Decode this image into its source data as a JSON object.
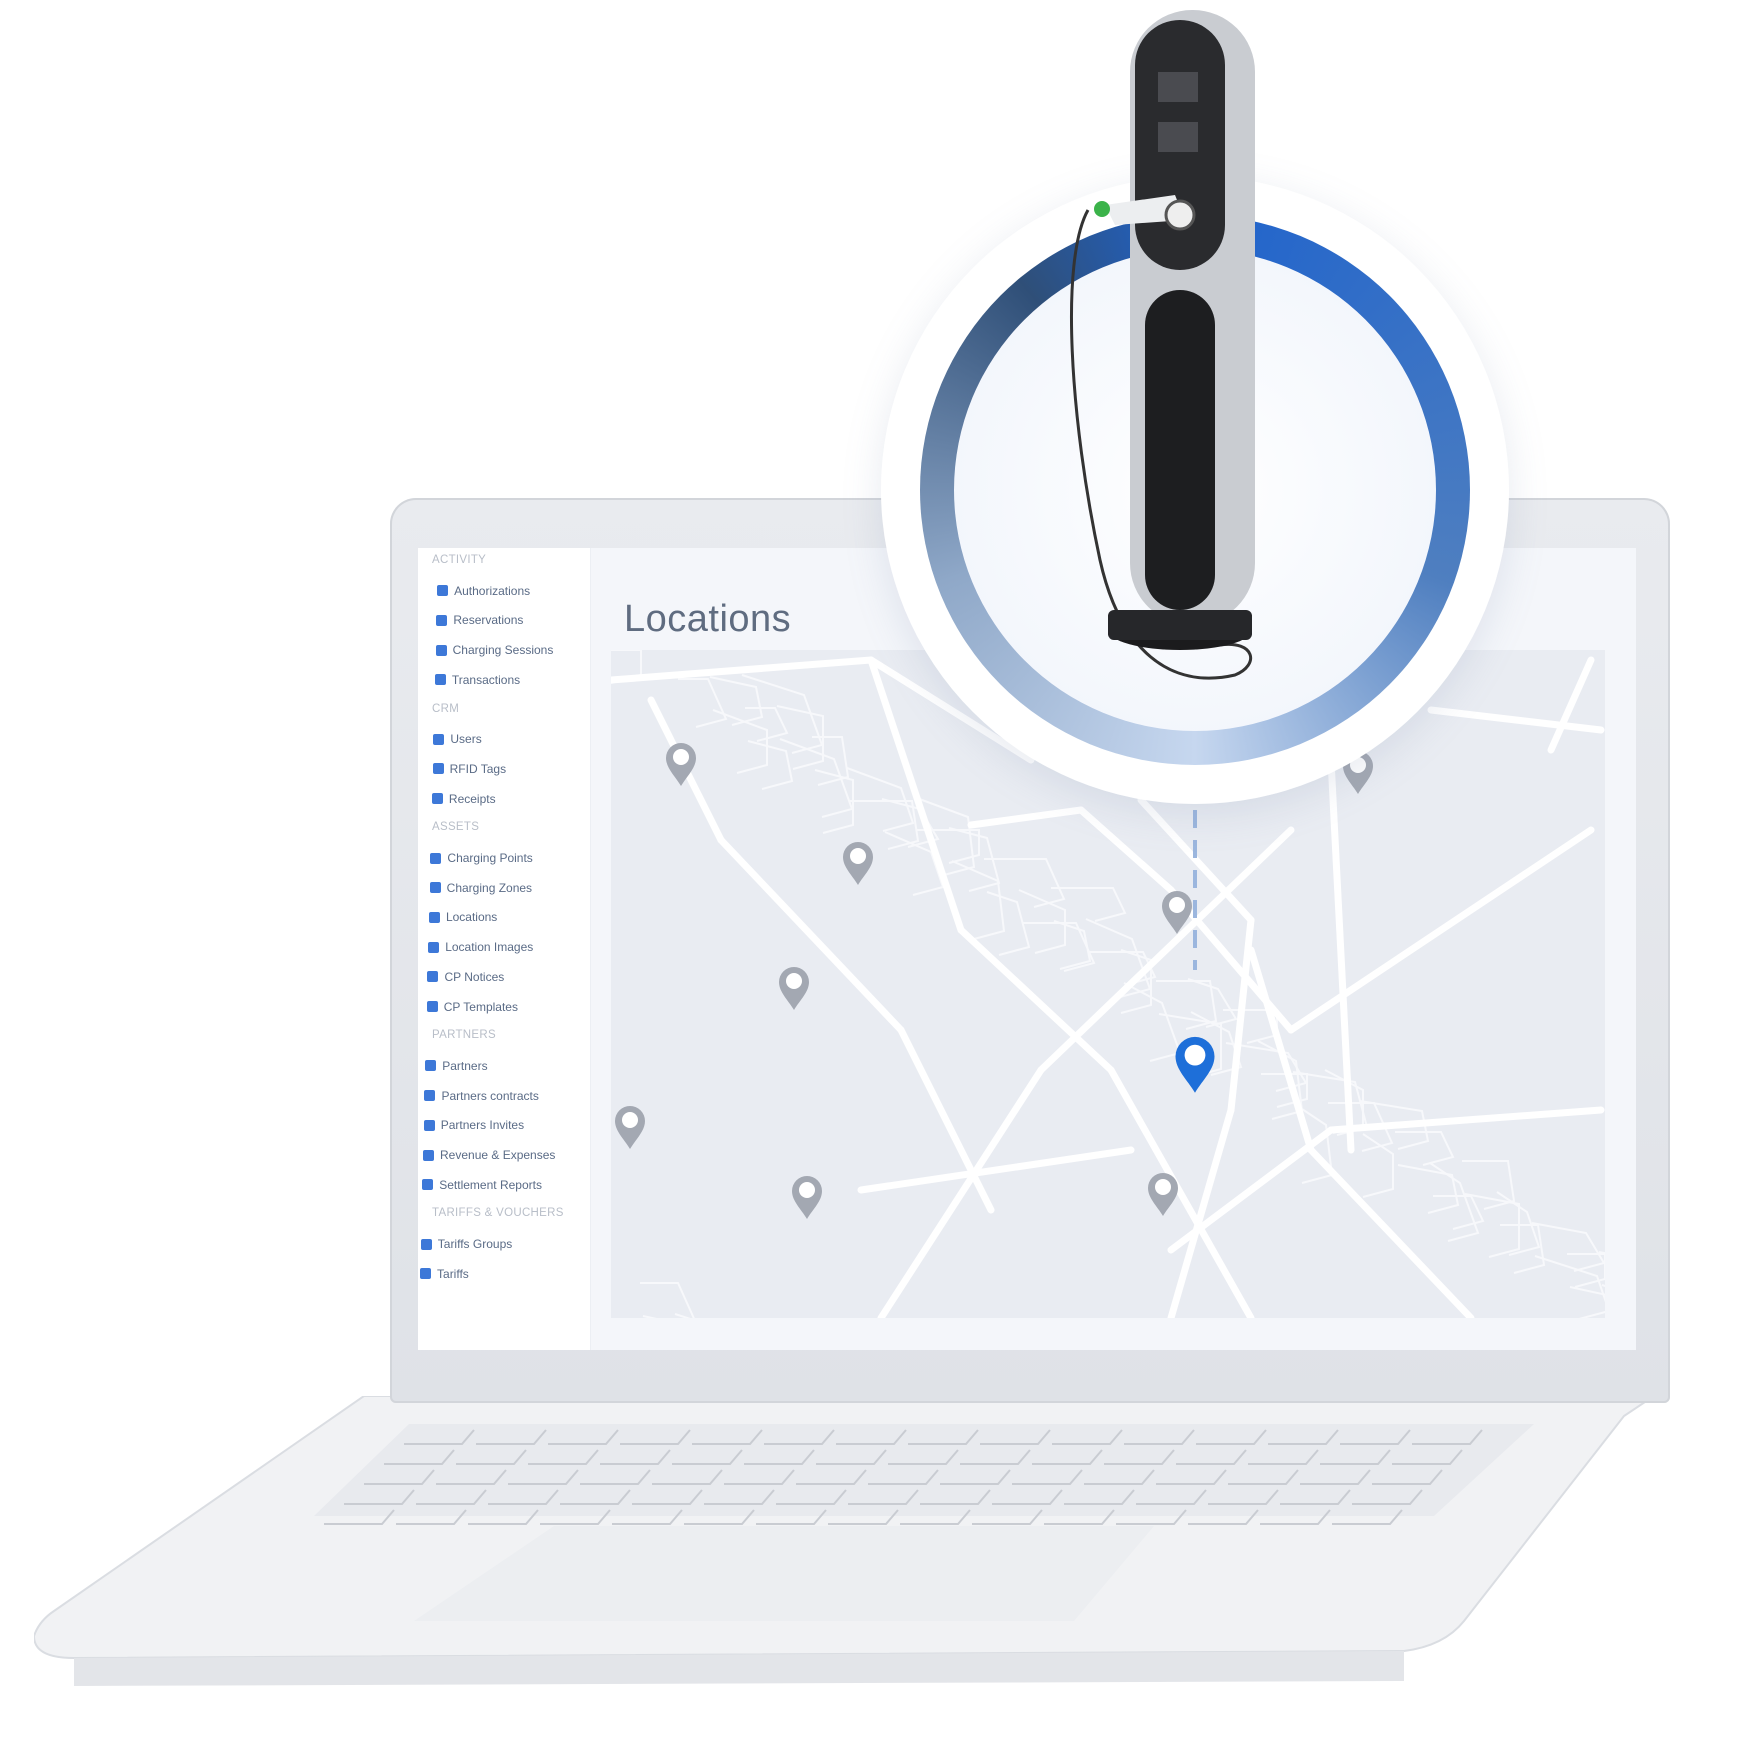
{
  "page": {
    "title": "Locations"
  },
  "sidebar": {
    "sections": [
      {
        "label": "ACTIVITY",
        "items": [
          {
            "label": "Authorizations",
            "icon": "lock-icon"
          },
          {
            "label": "Reservations",
            "icon": "reservation-icon"
          },
          {
            "label": "Charging Sessions",
            "icon": "bolt-icon"
          },
          {
            "label": "Transactions",
            "icon": "transfer-arrows-icon"
          }
        ]
      },
      {
        "label": "CRM",
        "items": [
          {
            "label": "Users",
            "icon": "users-icon"
          },
          {
            "label": "RFID Tags",
            "icon": "id-card-icon"
          },
          {
            "label": "Receipts",
            "icon": "receipt-icon"
          }
        ]
      },
      {
        "label": "ASSETS",
        "items": [
          {
            "label": "Charging Points",
            "icon": "charging-point-icon"
          },
          {
            "label": "Charging Zones",
            "icon": "map-pin-icon"
          },
          {
            "label": "Locations",
            "icon": "map-icon"
          },
          {
            "label": "Location Images",
            "icon": "image-icon"
          },
          {
            "label": "CP Notices",
            "icon": "bell-icon"
          },
          {
            "label": "CP Templates",
            "icon": "document-icon"
          }
        ]
      },
      {
        "label": "PARTNERS",
        "items": [
          {
            "label": "Partners",
            "icon": "user-icon"
          },
          {
            "label": "Partners contracts",
            "icon": "contract-icon"
          },
          {
            "label": "Partners Invites",
            "icon": "envelope-icon"
          },
          {
            "label": "Revenue & Expenses",
            "icon": "money-icon"
          },
          {
            "label": "Settlement Reports",
            "icon": "pie-chart-icon"
          }
        ]
      },
      {
        "label": "TARIFFS & VOUCHERS",
        "items": [
          {
            "label": "Tariffs Groups",
            "icon": "layers-icon"
          },
          {
            "label": "Tariffs",
            "icon": "tags-icon"
          }
        ]
      }
    ]
  },
  "map": {
    "pin_color": "#a3a8b2",
    "selected_pin_color": "#1e6fd9",
    "road_color": "#ffffff",
    "background": "#e9ecf2"
  },
  "accent": "#1f63cc"
}
